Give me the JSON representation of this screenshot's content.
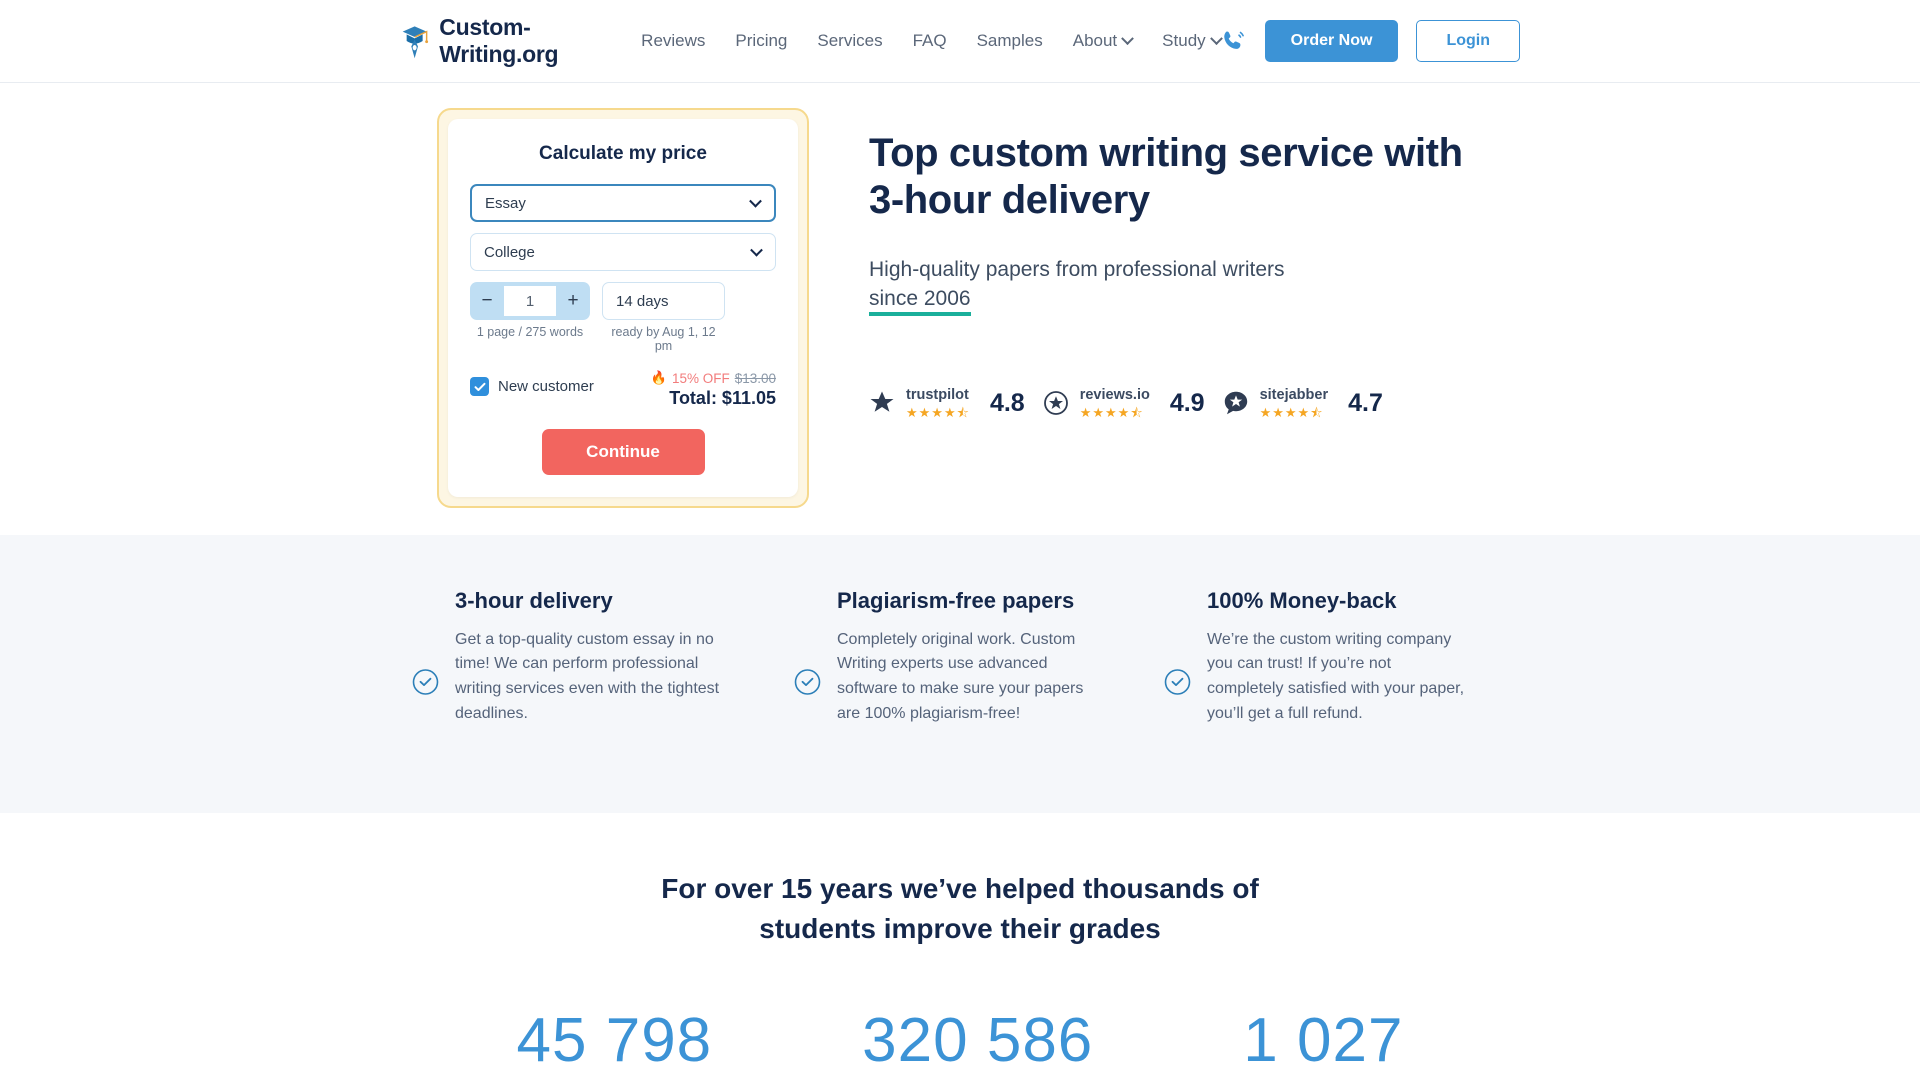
{
  "header": {
    "brand": {
      "name": "Custom-Writing.org",
      "logo_icon": "graduation-cap-pen-logo"
    },
    "nav": [
      {
        "label": "Reviews",
        "has_caret": false
      },
      {
        "label": "Pricing",
        "has_caret": false
      },
      {
        "label": "Services",
        "has_caret": false
      },
      {
        "label": "FAQ",
        "has_caret": false
      },
      {
        "label": "Samples",
        "has_caret": false
      },
      {
        "label": "About",
        "has_caret": true
      },
      {
        "label": "Study",
        "has_caret": true
      }
    ],
    "phone_icon": "phone-ring-icon",
    "order_button": "Order Now",
    "login_button": "Login",
    "accent_blue": "#3c93d6"
  },
  "calculator": {
    "title": "Calculate my price",
    "paper_type": "Essay",
    "academic_level": "College",
    "pages_value": "1",
    "minus_label": "−",
    "plus_label": "+",
    "pages_hint": "1 page / 275 words",
    "deadline": "14 days",
    "deadline_hint": "ready by Aug 1, 12 pm",
    "new_customer_label": "New customer",
    "new_customer_checked": true,
    "discount_badge": "15% OFF",
    "old_price": "$13.00",
    "total": "Total: $11.05",
    "continue_button": "Continue",
    "border_color": "#f6d98d",
    "continue_color": "#f2655f"
  },
  "hero": {
    "headline_line1": "Top custom writing service with",
    "headline_line2": "3-hour delivery",
    "sub_line1": "High-quality papers from professional writers",
    "sub_underlined": "since 2006",
    "underline_color": "#1aaf9b"
  },
  "reviews": [
    {
      "name": "trustpilot",
      "icon": "trustpilot-star-icon",
      "stars": "★★★★",
      "half": true,
      "score": "4.8"
    },
    {
      "name": "reviews.io",
      "icon": "reviews-io-circle-star-icon",
      "stars": "★★★★",
      "half": true,
      "score": "4.9"
    },
    {
      "name": "sitejabber",
      "icon": "sitejabber-bubble-star-icon",
      "stars": "★★★★",
      "half": true,
      "score": "4.7"
    }
  ],
  "features": [
    {
      "icon": "check-circle-icon",
      "title": "3-hour delivery",
      "body": "Get a top-quality custom essay in no time! We can perform professional writing services even with the tightest deadlines."
    },
    {
      "icon": "check-circle-icon",
      "title": "Plagiarism-free papers",
      "body": "Completely original work. Custom Writing experts use advanced software to make sure your papers are 100% plagiarism-free!"
    },
    {
      "icon": "check-circle-icon",
      "title": "100% Money-back",
      "body": "We’re the custom writing company you can trust! If you’re not completely satisfied with your paper, you’ll get a full refund."
    }
  ],
  "stats": {
    "heading_line1": "For over 15 years we’ve helped thousands of",
    "heading_line2": "students improve their grades",
    "numbers": [
      "45 798",
      "320 586",
      "1 027"
    ]
  }
}
